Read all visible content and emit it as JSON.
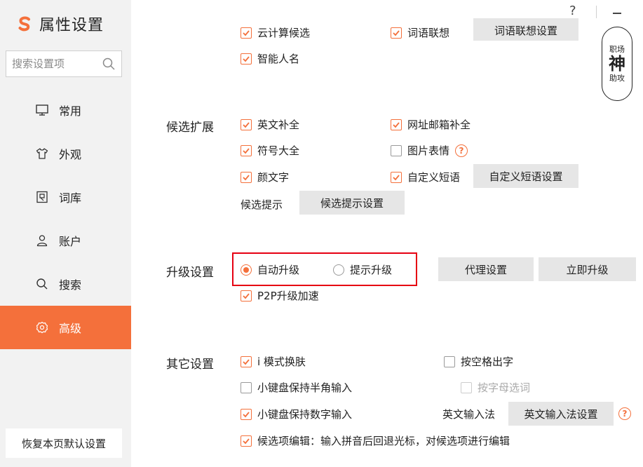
{
  "brand": {
    "title": "属性设置",
    "accent": "#f4703b"
  },
  "search": {
    "placeholder": "搜索设置项"
  },
  "nav": {
    "items": [
      {
        "label": "常用",
        "icon": "monitor-icon"
      },
      {
        "label": "外观",
        "icon": "shirt-icon"
      },
      {
        "label": "词库",
        "icon": "dictionary-icon"
      },
      {
        "label": "账户",
        "icon": "user-icon"
      },
      {
        "label": "搜索",
        "icon": "search-icon"
      },
      {
        "label": "高级",
        "icon": "gear-icon",
        "active": true
      }
    ]
  },
  "reset_label": "恢复本页默认设置",
  "window": {
    "help": "?",
    "minimize": "–"
  },
  "stamp": {
    "top": "职场",
    "mid": "神",
    "bot": "助攻"
  },
  "top_cut": {
    "items": [
      {
        "label": "云计算候选",
        "checked": true
      },
      {
        "label": "词语联想",
        "checked": true
      }
    ],
    "button": "词语联想设置"
  },
  "smart_name": {
    "label": "智能人名",
    "checked": true
  },
  "candidate_ext": {
    "label": "候选扩展",
    "items": [
      {
        "label": "英文补全",
        "checked": true
      },
      {
        "label": "网址邮箱补全",
        "checked": true
      },
      {
        "label": "符号大全",
        "checked": true
      },
      {
        "label": "图片表情",
        "checked": false
      },
      {
        "label": "颜文字",
        "checked": true
      },
      {
        "label": "自定义短语",
        "checked": true
      }
    ],
    "custom_phrase_button": "自定义短语设置",
    "hint_label": "候选提示",
    "hint_button": "候选提示设置"
  },
  "upgrade": {
    "label": "升级设置",
    "options": [
      {
        "label": "自动升级",
        "selected": true
      },
      {
        "label": "提示升级",
        "selected": false
      }
    ],
    "proxy_button": "代理设置",
    "upgrade_now_button": "立即升级",
    "p2p": {
      "label": "P2P升级加速",
      "checked": true
    }
  },
  "other": {
    "label": "其它设置",
    "items": [
      {
        "label": "i 模式换肤",
        "checked": true
      },
      {
        "label": "按空格出字",
        "checked": false
      },
      {
        "label": "小键盘保持半角输入",
        "checked": false
      },
      {
        "label": "按字母选词",
        "checked": false,
        "disabled": true
      },
      {
        "label": "小键盘保持数字输入",
        "checked": true
      },
      {
        "label": "候选项编辑：输入拼音后回退光标，对候选项进行编辑",
        "checked": true
      }
    ],
    "english_ime_label": "英文输入法",
    "english_ime_button": "英文输入法设置"
  },
  "highlight_color": "#e60012"
}
